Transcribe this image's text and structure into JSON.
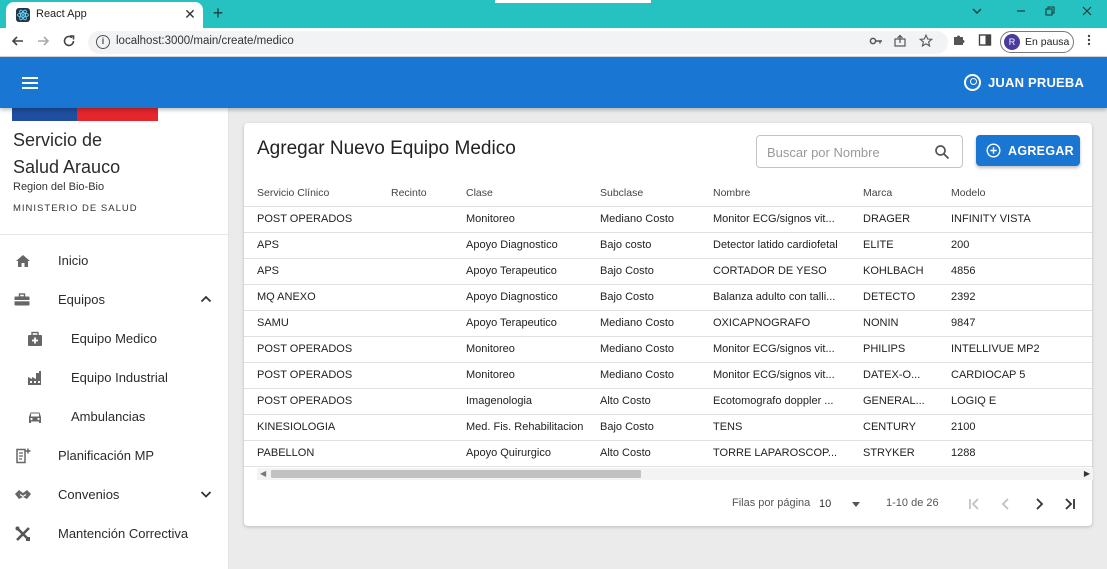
{
  "browser": {
    "tab_title": "React App",
    "tab_close": "✕",
    "new_tab": "+",
    "url": "localhost:3000/main/create/medico",
    "profile_initial": "R",
    "profile_status": "En pausa",
    "window_controls": [
      "chevron-down",
      "minimize",
      "restore",
      "close"
    ]
  },
  "appbar": {
    "user_name": "JUAN PRUEBA"
  },
  "sidebar": {
    "org_name_line1": "Servicio de",
    "org_name_line2": "Salud Arauco",
    "region": "Region del Bio-Bio",
    "ministry": "MINISTERIO DE SALUD",
    "items": [
      {
        "label": "Inicio",
        "icon": "home-icon"
      },
      {
        "label": "Equipos",
        "icon": "equipment-icon",
        "expanded": true
      },
      {
        "label": "Equipo Medico",
        "icon": "medical-kit-icon"
      },
      {
        "label": "Equipo Industrial",
        "icon": "factory-icon"
      },
      {
        "label": "Ambulancias",
        "icon": "car-icon"
      },
      {
        "label": "Planificación MP",
        "icon": "note-add-icon"
      },
      {
        "label": "Convenios",
        "icon": "handshake-icon",
        "expanded": false
      },
      {
        "label": "Mantención Correctiva",
        "icon": "tools-icon"
      }
    ]
  },
  "main": {
    "title": "Agregar Nuevo Equipo Medico",
    "search_placeholder": "Buscar por Nombre",
    "add_label": "AGREGAR",
    "columns": [
      "Servicio Clínico",
      "Recinto",
      "Clase",
      "Subclase",
      "Nombre",
      "Marca",
      "Modelo"
    ],
    "rows": [
      [
        "POST OPERADOS",
        "",
        "Monitoreo",
        "Mediano Costo",
        "Monitor ECG/signos vit...",
        "DRAGER",
        "INFINITY VISTA"
      ],
      [
        "APS",
        "",
        "Apoyo Diagnostico",
        "Bajo costo",
        "Detector latido cardiofetal",
        "ELITE",
        "200"
      ],
      [
        "APS",
        "",
        "Apoyo Terapeutico",
        "Bajo Costo",
        "CORTADOR DE YESO",
        "KOHLBACH",
        "4856"
      ],
      [
        "MQ ANEXO",
        "",
        "Apoyo Diagnostico",
        "Bajo Costo",
        "Balanza adulto con talli...",
        "DETECTO",
        "2392"
      ],
      [
        "SAMU",
        "",
        "Apoyo Terapeutico",
        "Mediano Costo",
        "OXICAPNOGRAFO",
        "NONIN",
        "9847"
      ],
      [
        "POST OPERADOS",
        "",
        "Monitoreo",
        "Mediano Costo",
        "Monitor ECG/signos vit...",
        "PHILIPS",
        "INTELLIVUE MP2"
      ],
      [
        "POST OPERADOS",
        "",
        "Monitoreo",
        "Mediano Costo",
        "Monitor ECG/signos vit...",
        "DATEX-O...",
        "CARDIOCAP 5"
      ],
      [
        "POST OPERADOS",
        "",
        "Imagenologia",
        "Alto Costo",
        "Ecotomografo doppler ...",
        "GENERAL...",
        "LOGIQ E"
      ],
      [
        "KINESIOLOGIA",
        "",
        "Med. Fis. Rehabilitacion",
        "Bajo Costo",
        "TENS",
        "CENTURY",
        "2100"
      ],
      [
        "PABELLON",
        "",
        "Apoyo Quirurgico",
        "Alto Costo",
        "TORRE LAPAROSCOP...",
        "STRYKER",
        "1288"
      ]
    ],
    "pagination": {
      "rows_per_page_label": "Filas por página",
      "rows_per_page": "10",
      "range": "1-10 de 26"
    }
  }
}
